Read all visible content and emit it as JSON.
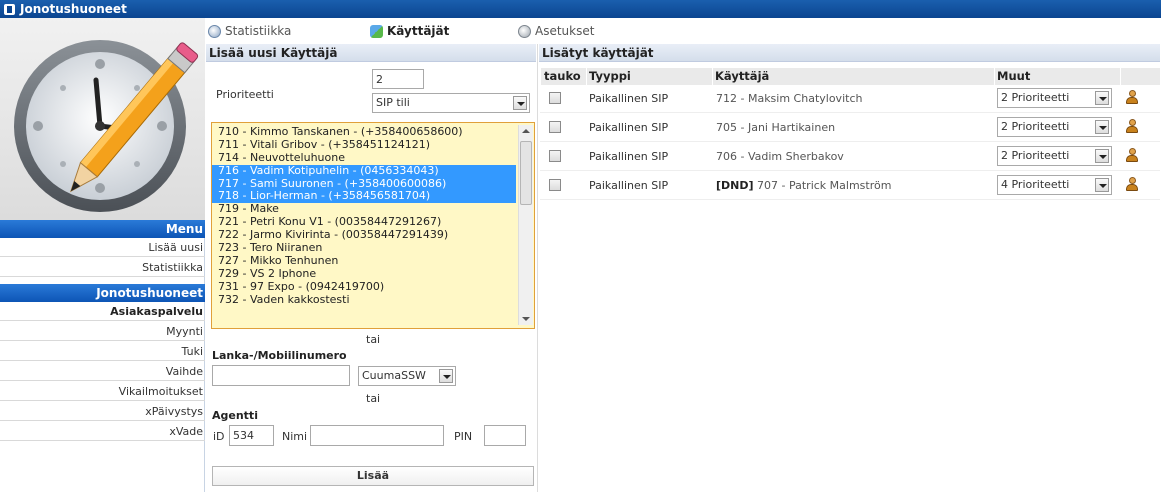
{
  "window": {
    "title": "Jonotushuoneet"
  },
  "sidebar": {
    "header_menu": "Menu",
    "items_top": [
      "Lisää uusi",
      "Statistiikka"
    ],
    "header_queue": "Jonotushuoneet",
    "items_queue": [
      "Asiakaspalvelu",
      "Myynti",
      "Tuki",
      "Vaihde",
      "Vikailmoitukset",
      "xPäivystys",
      "xVade"
    ]
  },
  "tabs": [
    {
      "label": "Statistiikka",
      "icon": "chart-icon",
      "active": false
    },
    {
      "label": "Käyttäjät",
      "icon": "users-icon",
      "active": true
    },
    {
      "label": "Asetukset",
      "icon": "settings-icon",
      "active": false
    }
  ],
  "add_user": {
    "title": "Lisää uusi Käyttäjä",
    "priority_label": "Prioriteetti",
    "priority_value": "2",
    "account_type": "SIP tili",
    "sip_list": [
      {
        "text": "710 - Kimmo Tanskanen - (+358400658600)",
        "selected": false
      },
      {
        "text": "711 - Vitali Gribov - (+358451124121)",
        "selected": false
      },
      {
        "text": "714 - Neuvotteluhuone",
        "selected": false
      },
      {
        "text": "716 - Vadim Kotipuhelin - (0456334043)",
        "selected": true
      },
      {
        "text": "717 - Sami Suuronen - (+358400600086)",
        "selected": true
      },
      {
        "text": "718 - Lior-Herman - (+358456581704)",
        "selected": true
      },
      {
        "text": "719 - Make",
        "selected": false
      },
      {
        "text": "721 - Petri Konu V1 - (00358447291267)",
        "selected": false
      },
      {
        "text": "722 - Jarmo Kivirinta - (00358447291439)",
        "selected": false
      },
      {
        "text": "723 - Tero Niiranen",
        "selected": false
      },
      {
        "text": "727 - Mikko Tenhunen",
        "selected": false
      },
      {
        "text": "729 - VS 2 Iphone",
        "selected": false
      },
      {
        "text": "731 - 97 Expo - (0942419700)",
        "selected": false
      },
      {
        "text": "732 - Vaden kakkostesti",
        "selected": false
      }
    ],
    "or_text_1": "tai",
    "phone_label": "Lanka-/Mobiilinumero",
    "phone_value": "",
    "provider": "CuumaSSW",
    "or_text_2": "tai",
    "agent_label": "Agentti",
    "id_label": "iD",
    "id_value": "534",
    "name_label": "Nimi",
    "name_value": "",
    "pin_label": "PIN",
    "pin_value": "",
    "add_button": "Lisää"
  },
  "added_users": {
    "title": "Lisätyt käyttäjät",
    "columns": {
      "pause": "tauko",
      "type": "Tyyppi",
      "user": "Käyttäjä",
      "other": "Muut"
    },
    "rows": [
      {
        "type": "Paikallinen SIP",
        "dnd": "",
        "user": "712 - Maksim Chatylovitch",
        "priority": "2 Prioriteetti"
      },
      {
        "type": "Paikallinen SIP",
        "dnd": "",
        "user": "705 - Jani Hartikainen",
        "priority": "2 Prioriteetti"
      },
      {
        "type": "Paikallinen SIP",
        "dnd": "",
        "user": "706 - Vadim Sherbakov",
        "priority": "2 Prioriteetti"
      },
      {
        "type": "Paikallinen SIP",
        "dnd": "[DND]",
        "user": "707 - Patrick Malmström",
        "priority": "4 Prioriteetti"
      }
    ]
  },
  "colors": {
    "title_bar": "#0b4590",
    "menu_header": "#1565c8",
    "selection": "#3399ff",
    "list_bg": "#fff8c6"
  }
}
